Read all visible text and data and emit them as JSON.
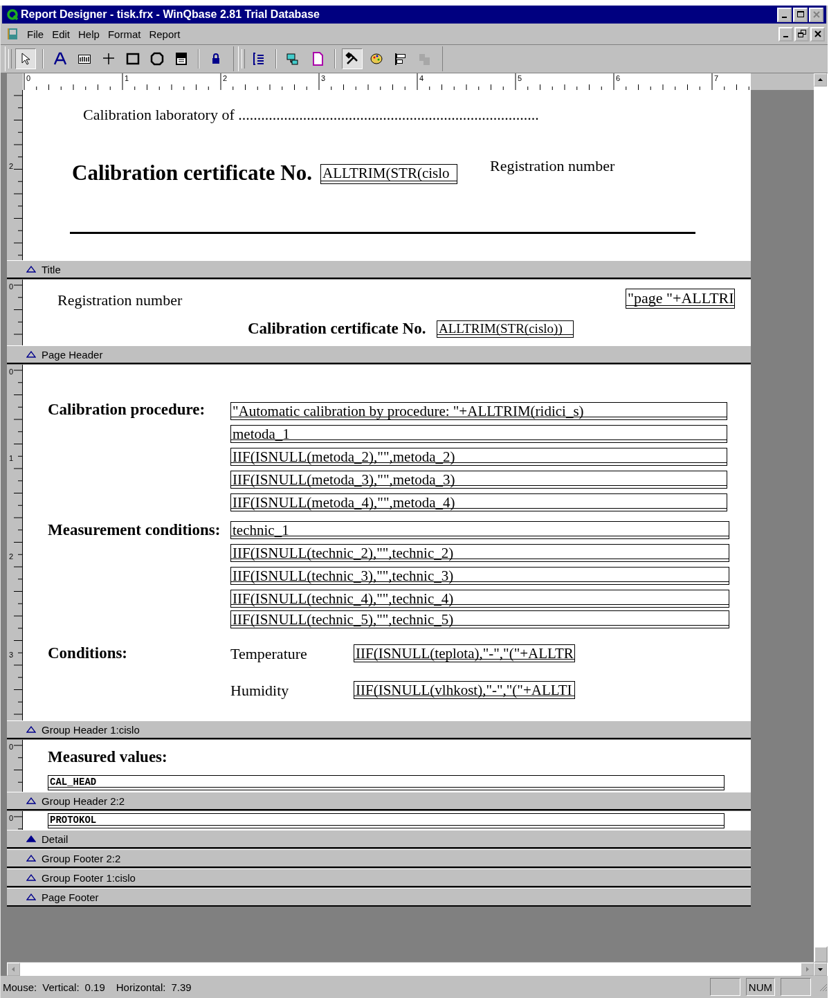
{
  "window": {
    "title": "Report Designer - tisk.frx - WinQbase 2.81  Trial Database"
  },
  "menu": [
    {
      "label": "File"
    },
    {
      "label": "Edit"
    },
    {
      "label": "Help"
    },
    {
      "label": "Format"
    },
    {
      "label": "Report"
    }
  ],
  "toolbars": [
    [
      {
        "kind": "pointer",
        "selected": true
      },
      {
        "kind": "label",
        "selected": false
      },
      {
        "kind": "field",
        "selected": false
      },
      {
        "kind": "line",
        "selected": false
      },
      {
        "kind": "rectangle",
        "selected": false
      },
      {
        "kind": "rounded",
        "selected": false
      },
      {
        "kind": "picture",
        "selected": false
      },
      {
        "kind": "lock",
        "selected": false
      }
    ],
    [
      {
        "kind": "data-grouping",
        "selected": false,
        "disabled": false
      },
      {
        "kind": "data-environment",
        "selected": false,
        "disabled": false
      },
      {
        "kind": "page",
        "selected": false,
        "disabled": false
      },
      {
        "kind": "tools",
        "selected": true,
        "disabled": false
      },
      {
        "kind": "palette",
        "selected": false,
        "disabled": false
      },
      {
        "kind": "align",
        "selected": false,
        "disabled": false
      },
      {
        "kind": "layout",
        "selected": false,
        "disabled": true
      }
    ]
  ],
  "ruler": {
    "labels": [
      "0",
      "1",
      "2",
      "3",
      "4",
      "5",
      "6",
      "7"
    ]
  },
  "bands": [
    {
      "ruler_labels": [
        "2"
      ],
      "items": [
        {
          "kind": "text",
          "text": "Calibration laboratory of ..............................................................................."
        },
        {
          "kind": "title",
          "text": "Calibration certificate No."
        },
        {
          "kind": "field",
          "text": "ALLTRIM(STR(cislo"
        },
        {
          "kind": "text",
          "text": "Registration number"
        },
        {
          "kind": "line"
        }
      ],
      "bar": {
        "label": "Title",
        "selected": false
      }
    },
    {
      "ruler_labels": [
        "0"
      ],
      "items": [
        {
          "kind": "text",
          "text": "Registration number"
        },
        {
          "kind": "field",
          "text": "\"page \"+ALLTRI"
        },
        {
          "kind": "heading",
          "text": "Calibration certificate No."
        },
        {
          "kind": "field",
          "text": "ALLTRIM(STR(cislo))"
        }
      ],
      "bar": {
        "label": "Page Header",
        "selected": false
      }
    },
    {
      "ruler_labels": [
        "0",
        "1",
        "2",
        "3"
      ],
      "items": [
        {
          "kind": "heading",
          "text": "Calibration procedure:"
        },
        {
          "kind": "field",
          "text": "\"Automatic calibration by procedure: \"+ALLTRIM(ridici_s)"
        },
        {
          "kind": "field",
          "text": "metoda_1"
        },
        {
          "kind": "field",
          "text": "IIF(ISNULL(metoda_2),\"\",metoda_2)"
        },
        {
          "kind": "field",
          "text": "IIF(ISNULL(metoda_3),\"\",metoda_3)"
        },
        {
          "kind": "field",
          "text": "IIF(ISNULL(metoda_4),\"\",metoda_4)"
        },
        {
          "kind": "heading",
          "text": "Measurement conditions:"
        },
        {
          "kind": "field",
          "text": "technic_1"
        },
        {
          "kind": "field",
          "text": "IIF(ISNULL(technic_2),\"\",technic_2)"
        },
        {
          "kind": "field",
          "text": "IIF(ISNULL(technic_3),\"\",technic_3)"
        },
        {
          "kind": "field",
          "text": "IIF(ISNULL(technic_4),\"\",technic_4)"
        },
        {
          "kind": "field",
          "text": "IIF(ISNULL(technic_5),\"\",technic_5)"
        },
        {
          "kind": "heading",
          "text": "Conditions:"
        },
        {
          "kind": "text",
          "text": "Temperature"
        },
        {
          "kind": "field",
          "text": "IIF(ISNULL(teplota),\"-\",\"(\"+ALLTR"
        },
        {
          "kind": "text",
          "text": "Humidity"
        },
        {
          "kind": "field",
          "text": "IIF(ISNULL(vlhkost),\"-\",\"(\"+ALLTI"
        }
      ],
      "bar": {
        "label": "Group Header 1:cislo",
        "selected": false
      }
    },
    {
      "ruler_labels": [
        "0"
      ],
      "items": [
        {
          "kind": "heading",
          "text": "Measured values:"
        },
        {
          "kind": "mono-field",
          "text": "CAL_HEAD"
        }
      ],
      "bar": {
        "label": "Group Header 2:2",
        "selected": false
      }
    },
    {
      "ruler_labels": [
        "0"
      ],
      "items": [
        {
          "kind": "mono-field",
          "text": "PROTOKOL"
        }
      ],
      "bar": {
        "label": "Detail",
        "selected": true
      }
    },
    {
      "bar": {
        "label": "Group Footer 2:2",
        "selected": false
      }
    },
    {
      "bar": {
        "label": "Group Footer 1:cislo",
        "selected": false
      }
    },
    {
      "bar": {
        "label": "Page Footer",
        "selected": false
      }
    }
  ],
  "status_bar": {
    "mouse_label": "Mouse:",
    "vertical_label": "Vertical:",
    "vertical": "0.19",
    "horizontal_label": "Horizontal:",
    "horizontal": "7.39",
    "indicators": [
      "NUM"
    ]
  }
}
